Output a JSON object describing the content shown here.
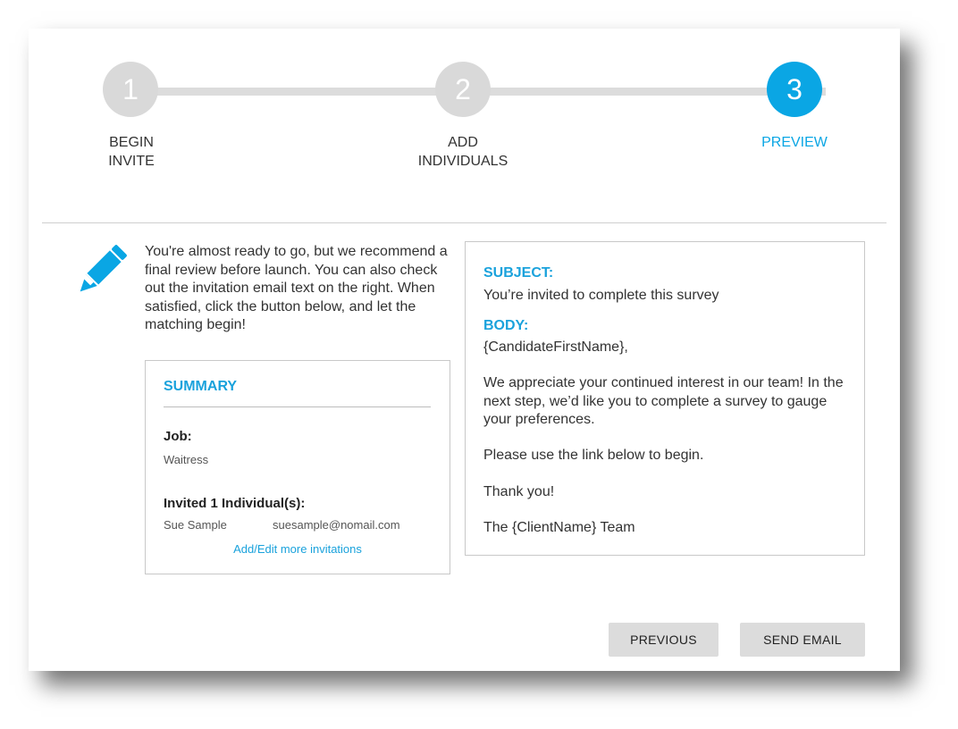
{
  "stepper": {
    "steps": [
      {
        "number": "1",
        "label_line1": "BEGIN",
        "label_line2": "INVITE"
      },
      {
        "number": "2",
        "label_line1": "ADD",
        "label_line2": "INDIVIDUALS"
      },
      {
        "number": "3",
        "label_line1": "PREVIEW",
        "label_line2": ""
      }
    ],
    "active_color": "#0aa6e4",
    "inactive_color": "#d9d9d9"
  },
  "intro": {
    "icon": "pencil-icon",
    "text": "You're almost ready to go, but we recommend a final review before launch. You can also check out the invitation email text on the right. When satisfied, click the button below, and let the matching begin!"
  },
  "summary": {
    "title": "SUMMARY",
    "job_label": "Job:",
    "job_value": "Waitress",
    "invited_label": "Invited 1 Individual(s):",
    "invitees": [
      {
        "name": "Sue Sample",
        "email": "suesample@nomail.com"
      }
    ],
    "edit_link": "Add/Edit more invitations"
  },
  "preview": {
    "subject_label": "SUBJECT:",
    "subject": "You’re invited to complete this survey",
    "body_label": "BODY:",
    "greeting": "{CandidateFirstName},",
    "paragraph": "We appreciate your continued interest in our team! In the next step, we’d like you to complete a survey to gauge your preferences.",
    "link_line": "Please use the link below to begin.",
    "thanks": "Thank you!",
    "signature": "The {ClientName} Team"
  },
  "buttons": {
    "previous": "PREVIOUS",
    "send": "SEND EMAIL"
  },
  "accent_color": "#1aa2dc"
}
